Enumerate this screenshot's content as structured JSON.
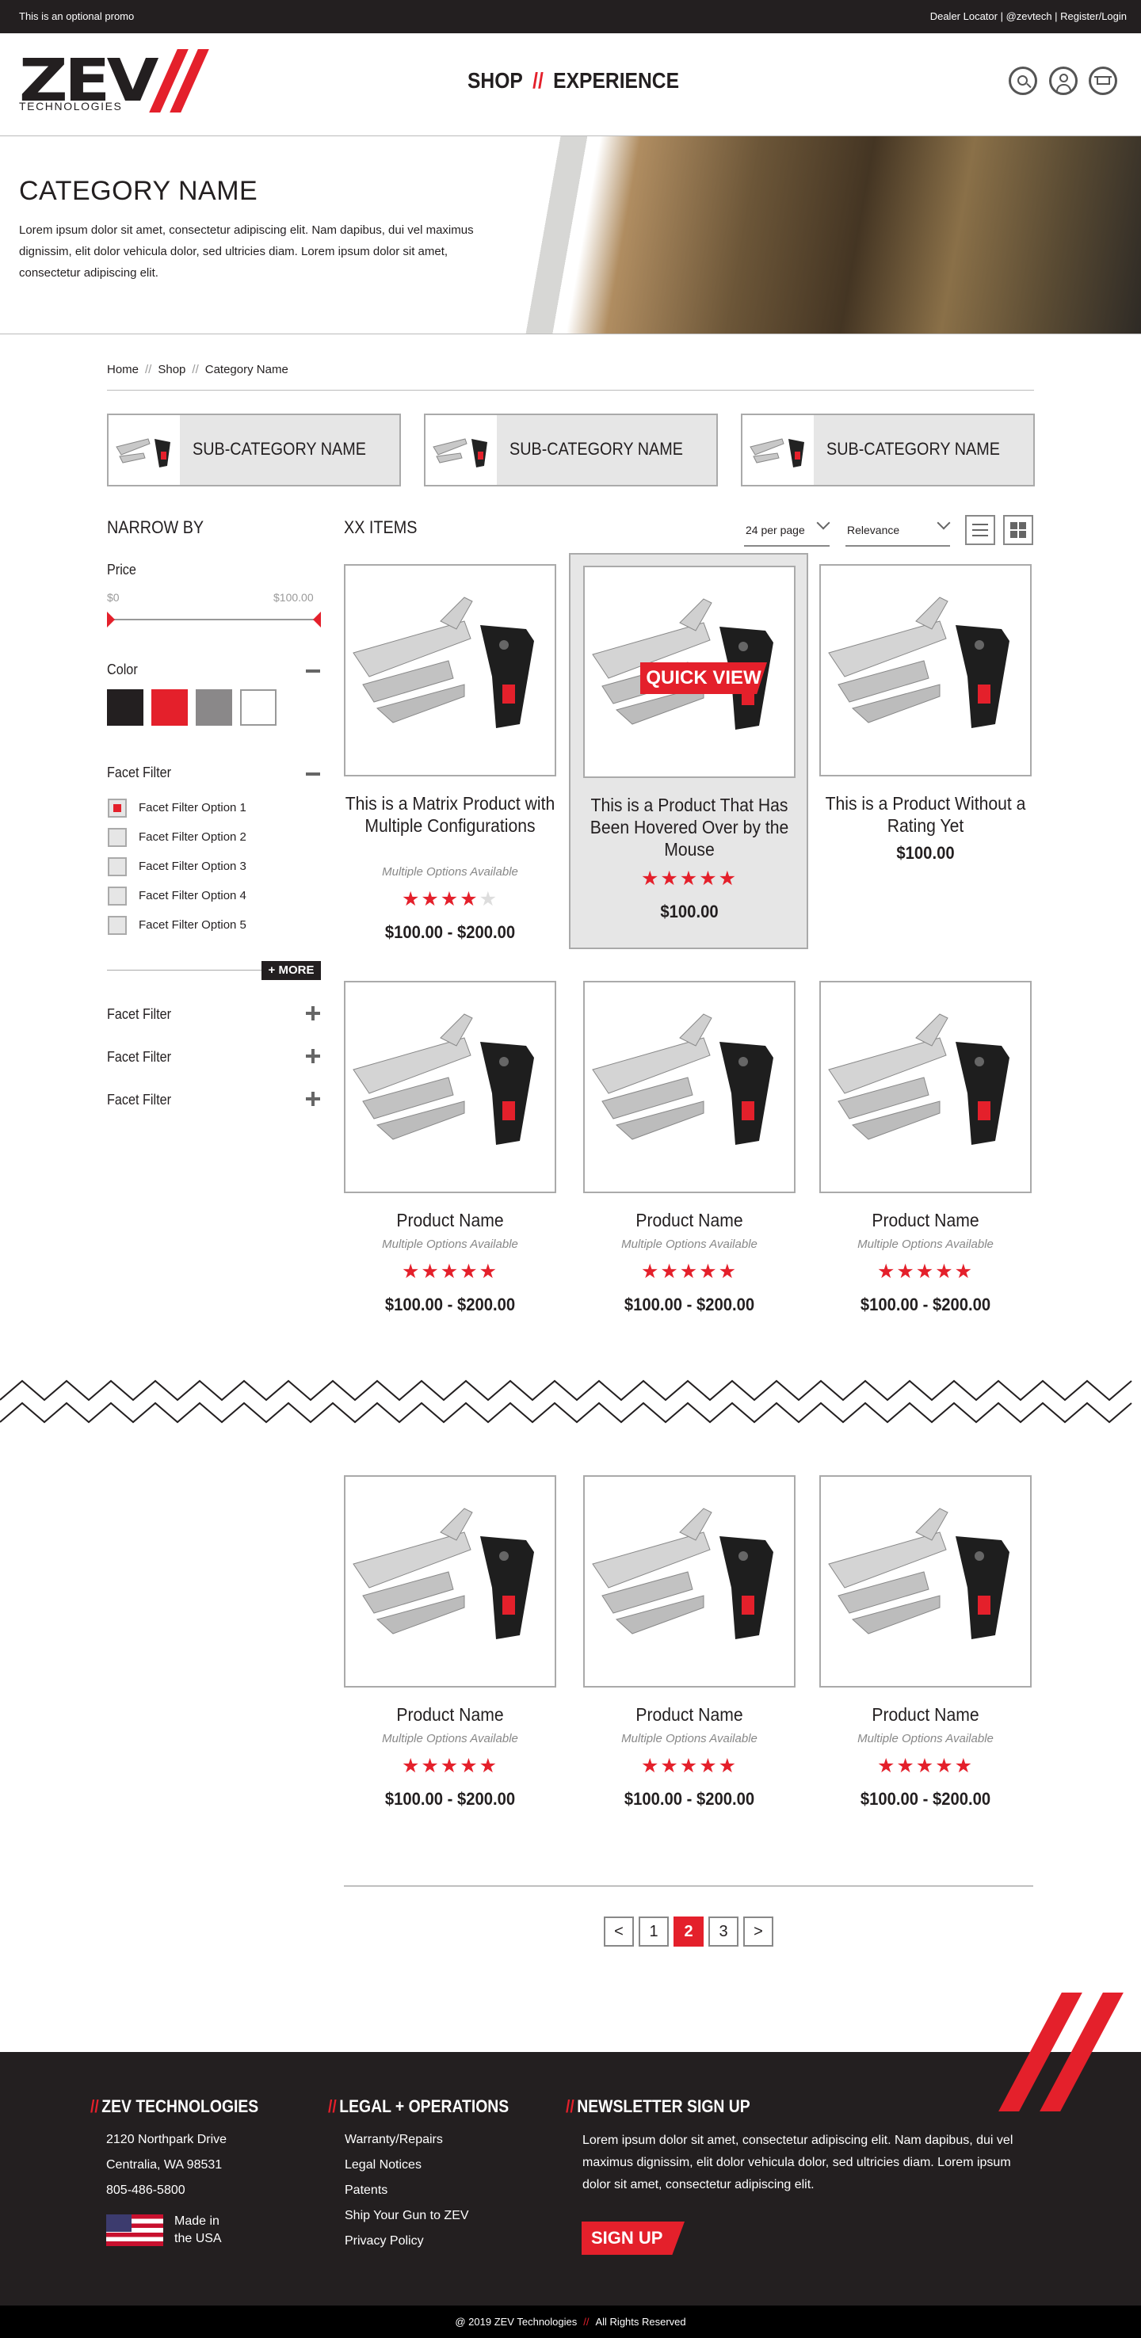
{
  "promo": {
    "left": "This is an optional promo",
    "right": "Dealer Locator | @zevtech | Register/Login"
  },
  "logo": {
    "brand": "ZEV",
    "sub": "TECHNOLOGIES"
  },
  "nav": {
    "shop": "SHOP",
    "sep": "//",
    "experience": "EXPERIENCE"
  },
  "hero": {
    "title": "CATEGORY NAME",
    "text": "Lorem ipsum dolor sit amet, consectetur adipiscing elit. Nam dapibus, dui vel maximus dignissim, elit dolor vehicula dolor, sed ultricies diam. Lorem ipsum dolor sit amet, consectetur adipiscing elit."
  },
  "breadcrumb": {
    "home": "Home",
    "shop": "Shop",
    "current": "Category Name",
    "sep": "//"
  },
  "subcategories": [
    "SUB-CATEGORY NAME",
    "SUB-CATEGORY NAME",
    "SUB-CATEGORY NAME"
  ],
  "filters": {
    "title": "NARROW BY",
    "price": {
      "label": "Price",
      "min": "$0",
      "max": "$100.00"
    },
    "color": {
      "label": "Color",
      "swatches": [
        "#231f20",
        "#e4202b",
        "#8a8889",
        "#ffffff"
      ]
    },
    "facet": {
      "label": "Facet Filter",
      "options": [
        "Facet Filter Option 1",
        "Facet Filter Option 2",
        "Facet Filter Option 3",
        "Facet Filter Option 4",
        "Facet Filter Option 5"
      ],
      "checked": 0,
      "more": "+ MORE"
    },
    "collapsed": [
      "Facet Filter",
      "Facet Filter",
      "Facet Filter"
    ]
  },
  "results": {
    "count": "XX ITEMS",
    "per_page": "24 per page",
    "sort": "Relevance"
  },
  "products": [
    {
      "name": "This is a Matrix Product with Multiple Configurations",
      "options": "Multiple Options Available",
      "rating": 4,
      "price": "$100.00 - $200.00"
    },
    {
      "name": "This is a Product That Has Been Hovered Over by the Mouse",
      "options": "",
      "rating": 5,
      "price": "$100.00",
      "quick_view": "QUICK VIEW"
    },
    {
      "name": "This is a Product Without a Rating Yet",
      "options": "",
      "rating": 0,
      "price": "$100.00"
    },
    {
      "name": "Product Name",
      "options": "Multiple Options Available",
      "rating": 5,
      "price": "$100.00 - $200.00"
    },
    {
      "name": "Product Name",
      "options": "Multiple Options Available",
      "rating": 5,
      "price": "$100.00 - $200.00"
    },
    {
      "name": "Product Name",
      "options": "Multiple Options Available",
      "rating": 5,
      "price": "$100.00 - $200.00"
    },
    {
      "name": "Product Name",
      "options": "Multiple Options Available",
      "rating": 5,
      "price": "$100.00 - $200.00"
    },
    {
      "name": "Product Name",
      "options": "Multiple Options Available",
      "rating": 5,
      "price": "$100.00 - $200.00"
    },
    {
      "name": "Product Name",
      "options": "Multiple Options Available",
      "rating": 5,
      "price": "$100.00 - $200.00"
    }
  ],
  "pagination": {
    "prev": "<",
    "pages": [
      "1",
      "2",
      "3"
    ],
    "current": "2",
    "next": ">"
  },
  "footer": {
    "company": {
      "title": "ZEV TECHNOLOGIES",
      "address1": "2120 Northpark Drive",
      "address2": "Centralia, WA 98531",
      "phone": "805-486-5800",
      "made": "Made in",
      "usa": "the USA"
    },
    "legal": {
      "title": "LEGAL + OPERATIONS",
      "links": [
        "Warranty/Repairs",
        "Legal Notices",
        "Patents",
        "Ship Your Gun to ZEV",
        "Privacy Policy"
      ]
    },
    "newsletter": {
      "title": "NEWSLETTER SIGN UP",
      "text": "Lorem ipsum dolor sit amet, consectetur adipiscing elit. Nam dapibus, dui vel maximus dignissim, elit dolor vehicula dolor, sed ultricies diam. Lorem ipsum dolor sit amet, consectetur adipiscing elit.",
      "button": "SIGN UP"
    },
    "slash": "//"
  },
  "bottom": {
    "copyright": "@ 2019 ZEV Technologies",
    "sep": "//",
    "rights": "All Rights Reserved"
  },
  "colors": {
    "accent": "#e4202b",
    "dark": "#231f20"
  }
}
